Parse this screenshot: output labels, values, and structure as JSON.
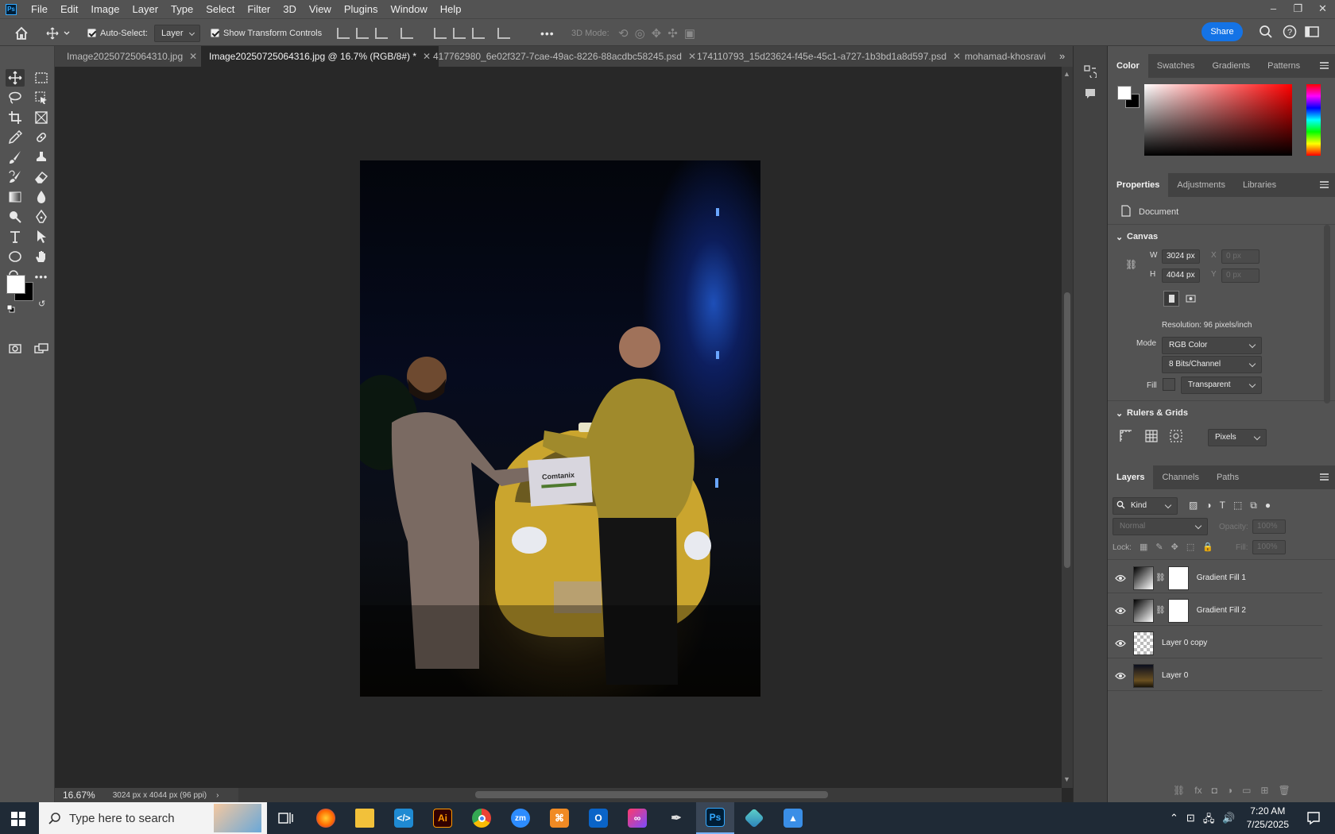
{
  "menubar": {
    "items": [
      "File",
      "Edit",
      "Image",
      "Layer",
      "Type",
      "Select",
      "Filter",
      "3D",
      "View",
      "Plugins",
      "Window",
      "Help"
    ]
  },
  "window_controls": {
    "minimize": "–",
    "restore": "❐",
    "close": "✕"
  },
  "options": {
    "auto_select_label": "Auto-Select:",
    "auto_select_target": "Layer",
    "show_transform_label": "Show Transform Controls",
    "more_label": "•••",
    "mode_3d_label": "3D Mode:",
    "share_label": "Share"
  },
  "tabs": [
    {
      "label": "Image20250725064310.jpg",
      "close": "✕"
    },
    {
      "label": "Image20250725064316.jpg @ 16.7% (RGB/8#) *",
      "close": "✕"
    },
    {
      "label": "417762980_6e02f327-7cae-49ac-8226-88acdbc58245.psd",
      "close": "✕"
    },
    {
      "label": "174110793_15d23624-f45e-45c1-a727-1b3bd1a8d597.psd",
      "close": "✕"
    },
    {
      "label": "mohamad-khosravi",
      "close": ""
    }
  ],
  "document": {
    "sign_text": "Comtanix"
  },
  "status": {
    "zoom": "16.67%",
    "dimensions": "3024 px x 4044 px (96 ppi)"
  },
  "color_panel": {
    "tabs": [
      "Color",
      "Swatches",
      "Gradients",
      "Patterns"
    ],
    "foreground": "#ffffff",
    "background": "#000000"
  },
  "properties": {
    "tabs": [
      "Properties",
      "Adjustments",
      "Libraries"
    ],
    "doc_label": "Document",
    "canvas_title": "Canvas",
    "w_label": "W",
    "w_value": "3024 px",
    "h_label": "H",
    "h_value": "4044 px",
    "x_label": "X",
    "x_placeholder": "0 px",
    "y_label": "Y",
    "y_placeholder": "0 px",
    "resolution": "Resolution: 96 pixels/inch",
    "mode_label": "Mode",
    "mode_value": "RGB Color",
    "bits_value": "8 Bits/Channel",
    "fill_label": "Fill",
    "fill_value": "Transparent",
    "rulers_title": "Rulers & Grids",
    "units_value": "Pixels"
  },
  "layers_panel": {
    "tabs": [
      "Layers",
      "Channels",
      "Paths"
    ],
    "kind_label": "Kind",
    "blend_mode": "Normal",
    "opacity_label": "Opacity:",
    "opacity_value": "100%",
    "lock_label": "Lock:",
    "fill_label": "Fill:",
    "fill_value": "100%",
    "layers": [
      {
        "name": "Gradient Fill 1",
        "type": "fill"
      },
      {
        "name": "Gradient Fill 2",
        "type": "fill"
      },
      {
        "name": "Layer 0 copy",
        "type": "empty"
      },
      {
        "name": "Layer 0",
        "type": "photo"
      }
    ]
  },
  "taskbar": {
    "search_placeholder": "Type here to search",
    "time": "7:20 AM",
    "date": "7/25/2025",
    "apps": [
      "Firefox",
      "File Explorer",
      "VS Code",
      "Illustrator",
      "Chrome",
      "Zoom",
      "Tool",
      "Outlook",
      "Creative Cloud",
      "Pen",
      "Photoshop",
      "App",
      "Photos"
    ]
  }
}
